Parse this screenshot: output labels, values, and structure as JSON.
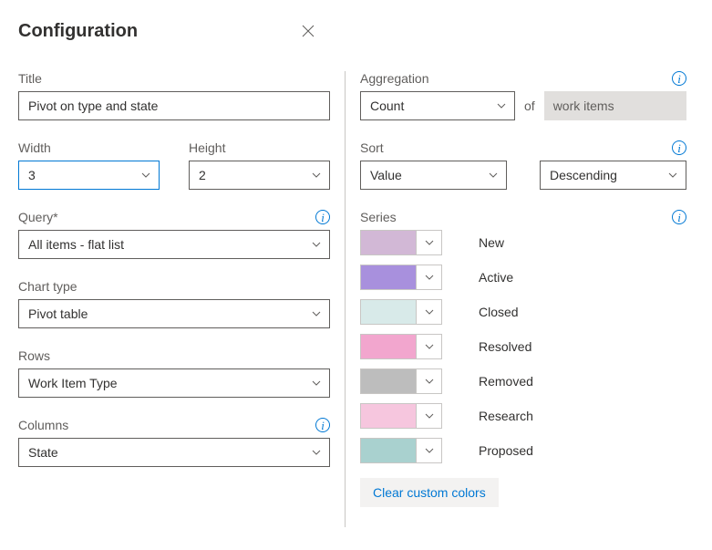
{
  "header": {
    "title": "Configuration"
  },
  "left": {
    "title_label": "Title",
    "title_value": "Pivot on type and state",
    "width_label": "Width",
    "width_value": "3",
    "height_label": "Height",
    "height_value": "2",
    "query_label": "Query*",
    "query_value": "All items - flat list",
    "chart_type_label": "Chart type",
    "chart_type_value": "Pivot table",
    "rows_label": "Rows",
    "rows_value": "Work Item Type",
    "columns_label": "Columns",
    "columns_value": "State"
  },
  "right": {
    "aggregation_label": "Aggregation",
    "aggregation_value": "Count",
    "of_label": "of",
    "aggregation_target": "work items",
    "sort_label": "Sort",
    "sort_by_value": "Value",
    "sort_dir_value": "Descending",
    "series_label": "Series",
    "series": [
      {
        "name": "New",
        "color": "#d2b8d6"
      },
      {
        "name": "Active",
        "color": "#a890dd"
      },
      {
        "name": "Closed",
        "color": "#d8eae9"
      },
      {
        "name": "Resolved",
        "color": "#f2a6ce"
      },
      {
        "name": "Removed",
        "color": "#bdbdbd"
      },
      {
        "name": "Research",
        "color": "#f6c6de"
      },
      {
        "name": "Proposed",
        "color": "#a9d1cf"
      }
    ],
    "clear_label": "Clear custom colors"
  }
}
